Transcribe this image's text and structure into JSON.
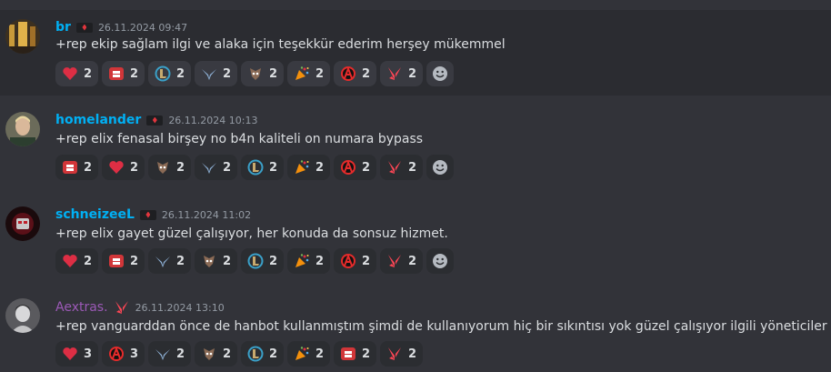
{
  "colors": {
    "user_cyan": "#00b0f4",
    "user_purple": "#9b59b6",
    "background": "#323339",
    "text": "#dbdee1",
    "timestamp": "#949ba4"
  },
  "messages": [
    {
      "username": "br",
      "timestamp": "26.11.2024 09:47",
      "text": "+rep ekip sağlam ilgi ve alaka için  teşekkür ederim herşey mükemmel",
      "reactions": [
        {
          "icon": "heart-icon",
          "count": "2"
        },
        {
          "icon": "fist-icon",
          "count": "2"
        },
        {
          "icon": "league-l-icon",
          "count": "2"
        },
        {
          "icon": "wings-icon",
          "count": "2"
        },
        {
          "icon": "mask-icon",
          "count": "2"
        },
        {
          "icon": "party-popper-icon",
          "count": "2"
        },
        {
          "icon": "anarchy-a-icon",
          "count": "2"
        },
        {
          "icon": "valorant-v-icon",
          "count": "2"
        }
      ]
    },
    {
      "username": "homelander",
      "timestamp": "26.11.2024 10:13",
      "text": "+rep elix fenasal birşey no b4n kaliteli on numara bypass",
      "reactions": [
        {
          "icon": "fist-icon",
          "count": "2"
        },
        {
          "icon": "heart-icon",
          "count": "2"
        },
        {
          "icon": "mask-icon",
          "count": "2"
        },
        {
          "icon": "wings-icon",
          "count": "2"
        },
        {
          "icon": "league-l-icon",
          "count": "2"
        },
        {
          "icon": "party-popper-icon",
          "count": "2"
        },
        {
          "icon": "anarchy-a-icon",
          "count": "2"
        },
        {
          "icon": "valorant-v-icon",
          "count": "2"
        }
      ]
    },
    {
      "username": "schneizeeL",
      "timestamp": "26.11.2024 11:02",
      "text": "+rep elix gayet güzel çalışıyor, her konuda da sonsuz hizmet.",
      "reactions": [
        {
          "icon": "heart-icon",
          "count": "2"
        },
        {
          "icon": "fist-icon",
          "count": "2"
        },
        {
          "icon": "wings-icon",
          "count": "2"
        },
        {
          "icon": "mask-icon",
          "count": "2"
        },
        {
          "icon": "league-l-icon",
          "count": "2"
        },
        {
          "icon": "party-popper-icon",
          "count": "2"
        },
        {
          "icon": "anarchy-a-icon",
          "count": "2"
        },
        {
          "icon": "valorant-v-icon",
          "count": "2"
        }
      ]
    },
    {
      "username": "Aextras.",
      "timestamp": "26.11.2024 13:10",
      "text": "+rep vanguarddan önce de hanbot kullanmıştım şimdi de kullanıyorum hiç bir sıkıntısı yok güzel çalışıyor ilgili yöneticiler",
      "reactions": [
        {
          "icon": "heart-icon",
          "count": "3"
        },
        {
          "icon": "anarchy-a-icon",
          "count": "3"
        },
        {
          "icon": "wings-icon",
          "count": "2"
        },
        {
          "icon": "mask-icon",
          "count": "2"
        },
        {
          "icon": "league-l-icon",
          "count": "2"
        },
        {
          "icon": "party-popper-icon",
          "count": "2"
        },
        {
          "icon": "fist-icon",
          "count": "2"
        },
        {
          "icon": "valorant-v-icon",
          "count": "2"
        }
      ]
    }
  ]
}
